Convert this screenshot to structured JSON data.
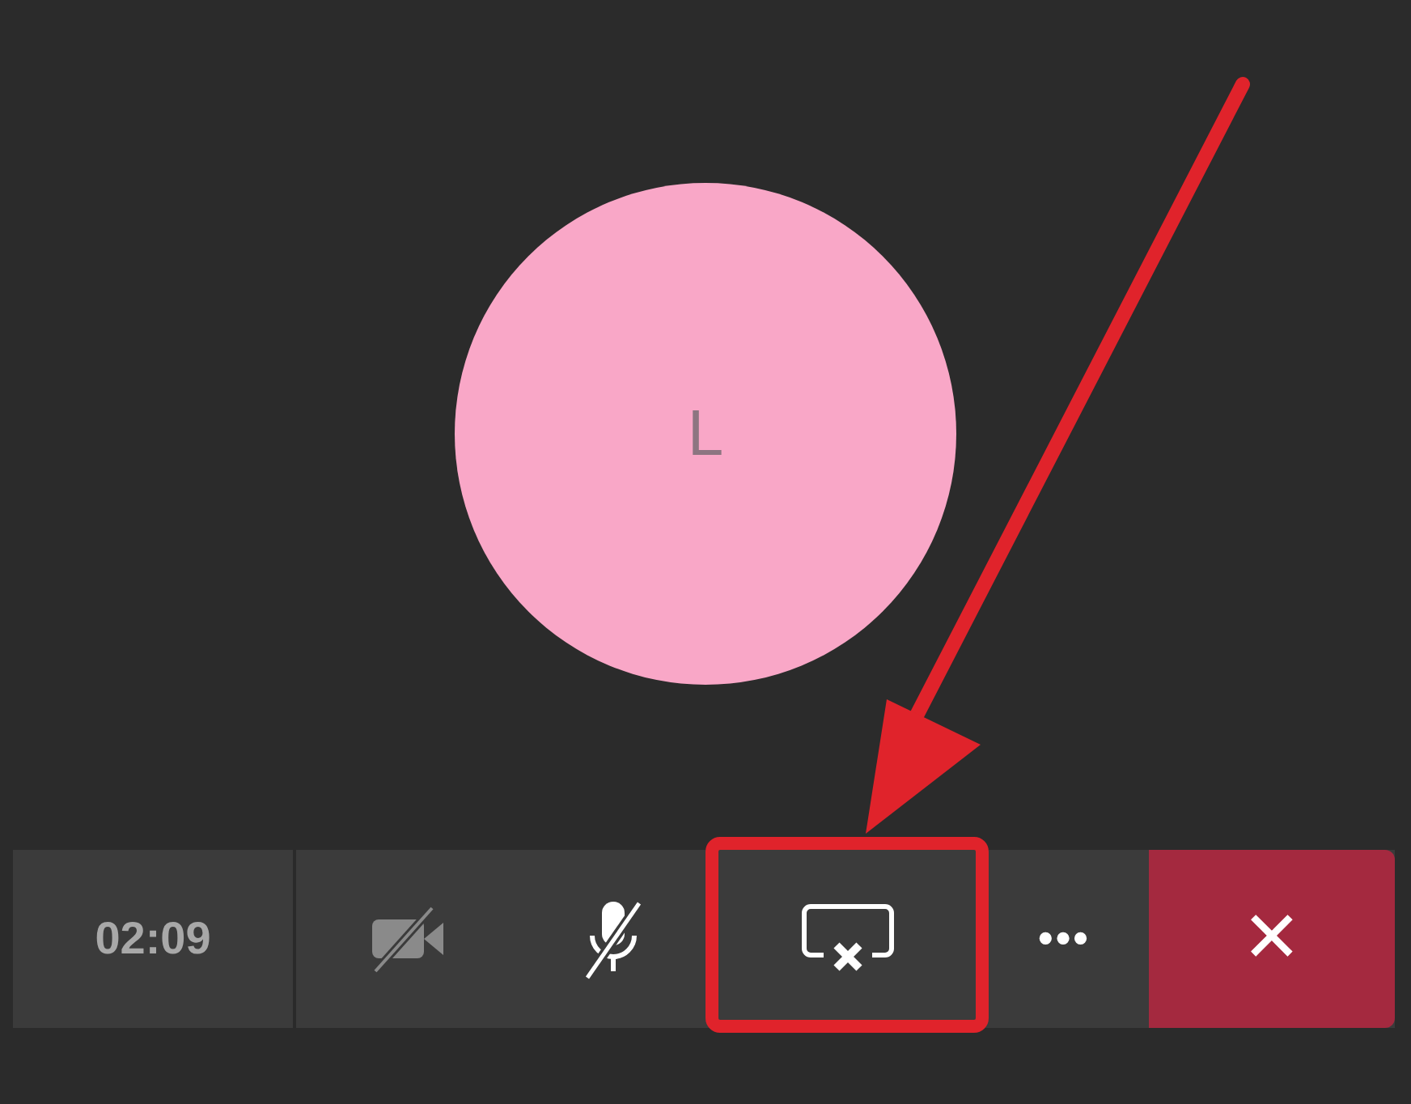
{
  "avatar": {
    "initial": "L"
  },
  "toolbar": {
    "timer": "02:09",
    "buttons": [
      {
        "kind": "camera",
        "on": false
      },
      {
        "kind": "mic",
        "muted": true
      },
      {
        "kind": "share"
      },
      {
        "kind": "more",
        "label": "•••"
      },
      {
        "kind": "hangup",
        "label": "✕"
      }
    ]
  }
}
